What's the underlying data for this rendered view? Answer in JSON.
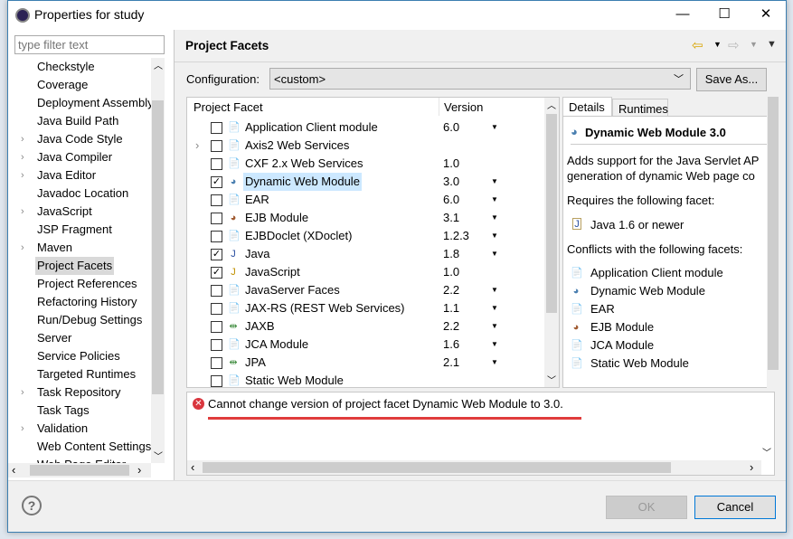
{
  "window": {
    "title": "Properties for study",
    "minimize": "—",
    "maximize": "☐",
    "close": "✕"
  },
  "sidebar": {
    "filter_placeholder": "type filter text",
    "items": [
      {
        "label": "Checkstyle",
        "expandable": false
      },
      {
        "label": "Coverage",
        "expandable": false
      },
      {
        "label": "Deployment Assembly",
        "expandable": false
      },
      {
        "label": "Java Build Path",
        "expandable": false
      },
      {
        "label": "Java Code Style",
        "expandable": true
      },
      {
        "label": "Java Compiler",
        "expandable": true
      },
      {
        "label": "Java Editor",
        "expandable": true
      },
      {
        "label": "Javadoc Location",
        "expandable": false
      },
      {
        "label": "JavaScript",
        "expandable": true
      },
      {
        "label": "JSP Fragment",
        "expandable": false
      },
      {
        "label": "Maven",
        "expandable": true
      },
      {
        "label": "Project Facets",
        "expandable": false,
        "selected": true
      },
      {
        "label": "Project References",
        "expandable": false
      },
      {
        "label": "Refactoring History",
        "expandable": false
      },
      {
        "label": "Run/Debug Settings",
        "expandable": false
      },
      {
        "label": "Server",
        "expandable": false
      },
      {
        "label": "Service Policies",
        "expandable": false
      },
      {
        "label": "Targeted Runtimes",
        "expandable": false
      },
      {
        "label": "Task Repository",
        "expandable": true
      },
      {
        "label": "Task Tags",
        "expandable": false
      },
      {
        "label": "Validation",
        "expandable": true
      },
      {
        "label": "Web Content Settings",
        "expandable": false
      },
      {
        "label": "Web Page Editor",
        "expandable": false
      }
    ]
  },
  "page": {
    "title": "Project Facets",
    "configuration_label": "Configuration:",
    "configuration_value": "<custom>",
    "save_as": "Save As..."
  },
  "facets": {
    "col_facet": "Project Facet",
    "col_version": "Version",
    "rows": [
      {
        "name": "Application Client module",
        "version": "6.0",
        "checked": false,
        "dropdown": true,
        "icon": "doc",
        "expand": false
      },
      {
        "name": "Axis2 Web Services",
        "version": "",
        "checked": false,
        "dropdown": false,
        "icon": "doc",
        "expand": true
      },
      {
        "name": "CXF 2.x Web Services",
        "version": "1.0",
        "checked": false,
        "dropdown": false,
        "icon": "doc",
        "expand": false
      },
      {
        "name": "Dynamic Web Module",
        "version": "3.0",
        "checked": true,
        "dropdown": true,
        "icon": "globe",
        "expand": false,
        "selected": true
      },
      {
        "name": "EAR",
        "version": "6.0",
        "checked": false,
        "dropdown": true,
        "icon": "doc",
        "expand": false
      },
      {
        "name": "EJB Module",
        "version": "3.1",
        "checked": false,
        "dropdown": true,
        "icon": "bean",
        "expand": false
      },
      {
        "name": "EJBDoclet (XDoclet)",
        "version": "1.2.3",
        "checked": false,
        "dropdown": true,
        "icon": "doc",
        "expand": false
      },
      {
        "name": "Java",
        "version": "1.8",
        "checked": true,
        "dropdown": true,
        "icon": "java",
        "expand": false
      },
      {
        "name": "JavaScript",
        "version": "1.0",
        "checked": true,
        "dropdown": false,
        "icon": "js",
        "expand": false
      },
      {
        "name": "JavaServer Faces",
        "version": "2.2",
        "checked": false,
        "dropdown": true,
        "icon": "doc",
        "expand": false
      },
      {
        "name": "JAX-RS (REST Web Services)",
        "version": "1.1",
        "checked": false,
        "dropdown": true,
        "icon": "doc",
        "expand": false
      },
      {
        "name": "JAXB",
        "version": "2.2",
        "checked": false,
        "dropdown": true,
        "icon": "arrows",
        "expand": false
      },
      {
        "name": "JCA Module",
        "version": "1.6",
        "checked": false,
        "dropdown": true,
        "icon": "doc",
        "expand": false
      },
      {
        "name": "JPA",
        "version": "2.1",
        "checked": false,
        "dropdown": true,
        "icon": "arrows",
        "expand": false
      },
      {
        "name": "Static Web Module",
        "version": "",
        "checked": false,
        "dropdown": false,
        "icon": "doc",
        "expand": false
      }
    ]
  },
  "details": {
    "tabs": [
      "Details",
      "Runtimes"
    ],
    "title": "Dynamic Web Module 3.0",
    "desc1": "Adds support for the Java Servlet AP",
    "desc2": "generation of dynamic Web page co",
    "requires_label": "Requires the following facet:",
    "requires": "Java 1.6 or newer",
    "conflicts_label": "Conflicts with the following facets:",
    "conflicts": [
      {
        "name": "Application Client module",
        "icon": "doc"
      },
      {
        "name": "Dynamic Web Module",
        "icon": "globe"
      },
      {
        "name": "EAR",
        "icon": "doc"
      },
      {
        "name": "EJB Module",
        "icon": "bean"
      },
      {
        "name": "JCA Module",
        "icon": "doc"
      },
      {
        "name": "Static Web Module",
        "icon": "doc"
      }
    ]
  },
  "message": {
    "text": "Cannot change version of project facet Dynamic Web Module to 3.0.",
    "underline_color": "#e03c3c"
  },
  "buttons": {
    "ok": "OK",
    "cancel": "Cancel"
  }
}
